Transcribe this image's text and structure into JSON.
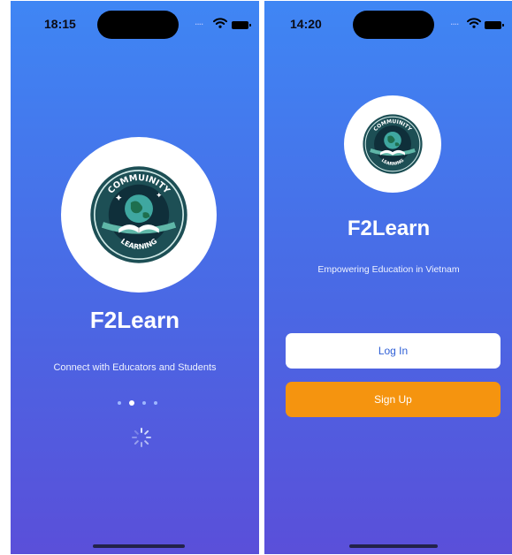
{
  "left_screen": {
    "status_bar": {
      "time": "18:15"
    },
    "app_name": "F2Learn",
    "tagline": "Connect with Educators and Students",
    "page_indicator": {
      "count": 4,
      "active_index": 1
    }
  },
  "right_screen": {
    "status_bar": {
      "time": "14:20"
    },
    "app_name": "F2Learn",
    "tagline": "Empowering Education in Vietnam",
    "buttons": {
      "login_label": "Log In",
      "signup_label": "Sign Up"
    }
  },
  "logo": {
    "top_text": "COMMUINITY",
    "bottom_text": "LEARNING"
  },
  "icons": [
    "wifi-icon",
    "battery-icon",
    "loading-spinner-icon",
    "globe-book-logo-icon"
  ],
  "colors": {
    "gradient_top": "#3f86f4",
    "gradient_bottom": "#5a4fd9",
    "signup_orange": "#f5940f",
    "login_text": "#2f5fd6",
    "emblem_ring": "#1d4f55"
  }
}
